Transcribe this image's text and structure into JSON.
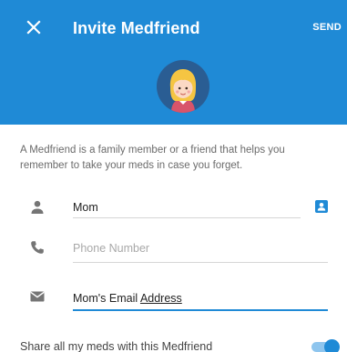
{
  "header": {
    "close_icon": "close-icon",
    "title": "Invite Medfriend",
    "send_label": "SEND",
    "avatar": "girl-avatar-icon"
  },
  "description": "A Medfriend is a family member or a friend that helps you remember to take your meds in case you forget.",
  "form": {
    "name": {
      "icon": "person-icon",
      "value": "Mom",
      "contact_button_icon": "contact-book-icon"
    },
    "phone": {
      "icon": "phone-icon",
      "placeholder": "Phone Number"
    },
    "email": {
      "icon": "email-icon",
      "value_prefix": "Mom's Email ",
      "value_underlined": "Address"
    }
  },
  "share": {
    "label": "Share all my meds with this Medfriend",
    "toggle_on": true
  },
  "colors": {
    "primary": "#1f8ad6",
    "icon_gray": "#757575",
    "text_muted": "#6b6b6b",
    "placeholder": "#a8a8a8"
  }
}
